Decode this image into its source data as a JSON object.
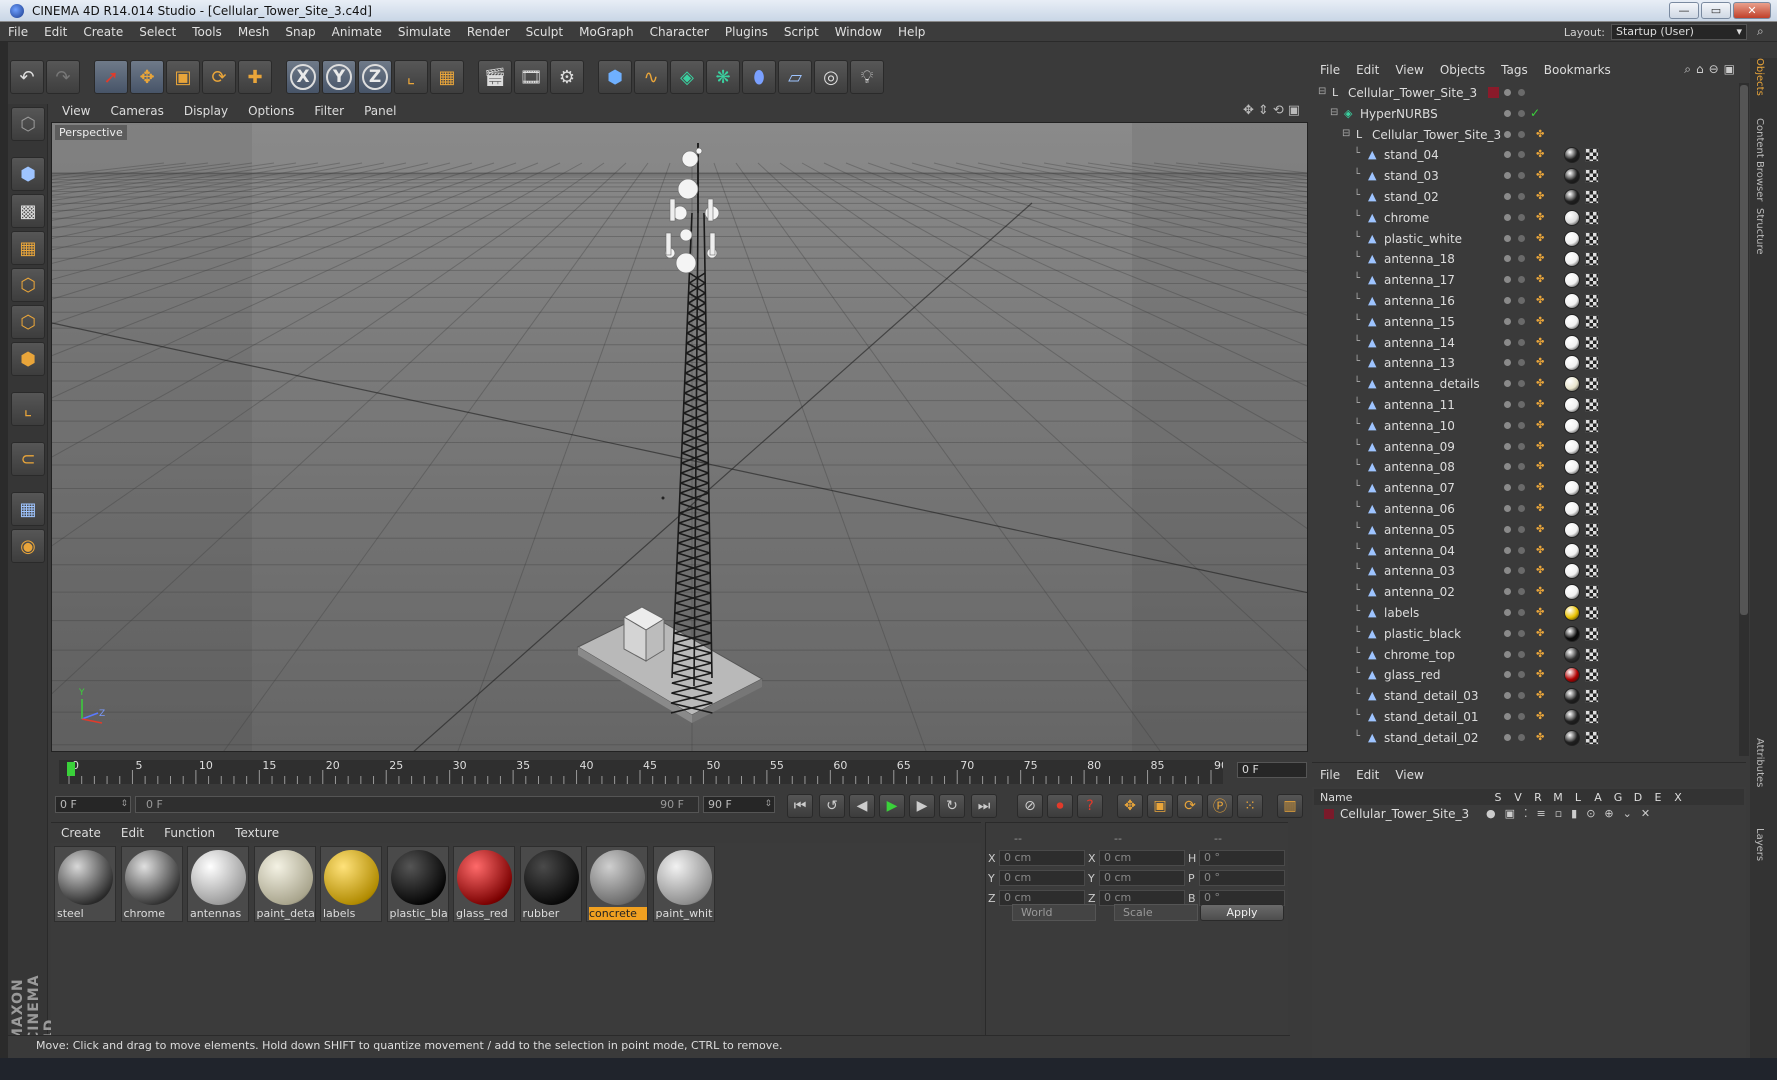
{
  "window": {
    "title": "CINEMA 4D R14.014 Studio - [Cellular_Tower_Site_3.c4d]",
    "buttons": {
      "minimize": "—",
      "maximize": "▭",
      "close": "✕"
    }
  },
  "menubar": {
    "items": [
      "File",
      "Edit",
      "Create",
      "Select",
      "Tools",
      "Mesh",
      "Snap",
      "Animate",
      "Simulate",
      "Render",
      "Sculpt",
      "MoGraph",
      "Character",
      "Plugins",
      "Script",
      "Window",
      "Help"
    ],
    "layout_label": "Layout:",
    "layout_value": "Startup (User)"
  },
  "viewport": {
    "menu": [
      "View",
      "Cameras",
      "Display",
      "Options",
      "Filter",
      "Panel"
    ],
    "label": "Perspective",
    "axis_y": "Y",
    "axis_z": "Z"
  },
  "timeline": {
    "ticks": [
      "0",
      "5",
      "10",
      "15",
      "20",
      "25",
      "30",
      "35",
      "40",
      "45",
      "50",
      "55",
      "60",
      "65",
      "70",
      "75",
      "80",
      "85",
      "90"
    ],
    "current_frame": "0 F"
  },
  "transport": {
    "start_field": "0 F",
    "slider_lo": "0 F",
    "slider_hi": "90 F",
    "end_field": "90 F"
  },
  "materials": {
    "menu": [
      "Create",
      "Edit",
      "Function",
      "Texture"
    ],
    "items": [
      {
        "name": "steel",
        "selected": false,
        "color_a": "#d8d8d8",
        "color_b": "#2a2a2a"
      },
      {
        "name": "chrome",
        "selected": false,
        "color_a": "#e0e0e0",
        "color_b": "#333333"
      },
      {
        "name": "antennas",
        "selected": false,
        "color_a": "#ffffff",
        "color_b": "#9a9a9a"
      },
      {
        "name": "paint_deta",
        "selected": false,
        "color_a": "#f4f2e4",
        "color_b": "#a8a48c"
      },
      {
        "name": "labels",
        "selected": false,
        "color_a": "#ffe27a",
        "color_b": "#b08a00"
      },
      {
        "name": "plastic_bla",
        "selected": false,
        "color_a": "#555555",
        "color_b": "#050505"
      },
      {
        "name": "glass_red",
        "selected": false,
        "color_a": "#ff6a6a",
        "color_b": "#7a0000"
      },
      {
        "name": "rubber",
        "selected": false,
        "color_a": "#4a4a4a",
        "color_b": "#080808"
      },
      {
        "name": "concrete",
        "selected": true,
        "color_a": "#cfcfcf",
        "color_b": "#6a6a6a"
      },
      {
        "name": "paint_whit",
        "selected": false,
        "color_a": "#f2f2f2",
        "color_b": "#8c8c8c"
      }
    ]
  },
  "coords": {
    "head_1": "--",
    "head_2": "--",
    "head_3": "--",
    "rows": [
      {
        "l1": "X",
        "v1": "0 cm",
        "l2": "X",
        "v2": "0 cm",
        "l3": "H",
        "v3": "0 °"
      },
      {
        "l1": "Y",
        "v1": "0 cm",
        "l2": "Y",
        "v2": "0 cm",
        "l3": "P",
        "v3": "0 °"
      },
      {
        "l1": "Z",
        "v1": "0 cm",
        "l2": "Z",
        "v2": "0 cm",
        "l3": "B",
        "v3": "0 °"
      }
    ],
    "world": "World",
    "scale": "Scale",
    "apply": "Apply"
  },
  "status": {
    "text": "Move: Click and drag to move elements. Hold down SHIFT to quantize movement / add to the selection in point mode, CTRL to remove."
  },
  "object_manager": {
    "menu": [
      "File",
      "Edit",
      "View",
      "Objects",
      "Tags",
      "Bookmarks"
    ],
    "objects": [
      {
        "name": "Cellular_Tower_Site_3",
        "level": 0,
        "type": "null",
        "material": ""
      },
      {
        "name": "HyperNURBS",
        "level": 1,
        "type": "nurbs",
        "material": ""
      },
      {
        "name": "Cellular_Tower_Site_3",
        "level": 2,
        "type": "null",
        "material": ""
      },
      {
        "name": "stand_04",
        "level": 3,
        "type": "poly",
        "material": "#202020"
      },
      {
        "name": "stand_03",
        "level": 3,
        "type": "poly",
        "material": "#202020"
      },
      {
        "name": "stand_02",
        "level": 3,
        "type": "poly",
        "material": "#202020"
      },
      {
        "name": "chrome",
        "level": 3,
        "type": "poly",
        "material": "#dcdcdc"
      },
      {
        "name": "plastic_white",
        "level": 3,
        "type": "poly",
        "material": "#f0f0f0"
      },
      {
        "name": "antenna_18",
        "level": 3,
        "type": "poly",
        "material": "#f0f0f0"
      },
      {
        "name": "antenna_17",
        "level": 3,
        "type": "poly",
        "material": "#f0f0f0"
      },
      {
        "name": "antenna_16",
        "level": 3,
        "type": "poly",
        "material": "#f0f0f0"
      },
      {
        "name": "antenna_15",
        "level": 3,
        "type": "poly",
        "material": "#f0f0f0"
      },
      {
        "name": "antenna_14",
        "level": 3,
        "type": "poly",
        "material": "#f0f0f0"
      },
      {
        "name": "antenna_13",
        "level": 3,
        "type": "poly",
        "material": "#f0f0f0"
      },
      {
        "name": "antenna_details",
        "level": 3,
        "type": "poly",
        "material": "#e8e4cc"
      },
      {
        "name": "antenna_11",
        "level": 3,
        "type": "poly",
        "material": "#f0f0f0"
      },
      {
        "name": "antenna_10",
        "level": 3,
        "type": "poly",
        "material": "#f0f0f0"
      },
      {
        "name": "antenna_09",
        "level": 3,
        "type": "poly",
        "material": "#f0f0f0"
      },
      {
        "name": "antenna_08",
        "level": 3,
        "type": "poly",
        "material": "#f0f0f0"
      },
      {
        "name": "antenna_07",
        "level": 3,
        "type": "poly",
        "material": "#f0f0f0"
      },
      {
        "name": "antenna_06",
        "level": 3,
        "type": "poly",
        "material": "#f0f0f0"
      },
      {
        "name": "antenna_05",
        "level": 3,
        "type": "poly",
        "material": "#f0f0f0"
      },
      {
        "name": "antenna_04",
        "level": 3,
        "type": "poly",
        "material": "#f0f0f0"
      },
      {
        "name": "antenna_03",
        "level": 3,
        "type": "poly",
        "material": "#f0f0f0"
      },
      {
        "name": "antenna_02",
        "level": 3,
        "type": "poly",
        "material": "#f0f0f0"
      },
      {
        "name": "labels",
        "level": 3,
        "type": "poly",
        "material": "#e8c000"
      },
      {
        "name": "plastic_black",
        "level": 3,
        "type": "poly",
        "material": "#0a0a0a"
      },
      {
        "name": "chrome_top",
        "level": 3,
        "type": "poly",
        "material": "#303030"
      },
      {
        "name": "glass_red",
        "level": 3,
        "type": "poly",
        "material": "#b00000"
      },
      {
        "name": "stand_detail_03",
        "level": 3,
        "type": "poly",
        "material": "#202020"
      },
      {
        "name": "stand_detail_01",
        "level": 3,
        "type": "poly",
        "material": "#202020"
      },
      {
        "name": "stand_detail_02",
        "level": 3,
        "type": "poly",
        "material": "#202020"
      }
    ]
  },
  "attribute_manager": {
    "menu": [
      "File",
      "Edit",
      "View"
    ],
    "header_name": "Name",
    "header_cols": [
      "S",
      "V",
      "R",
      "M",
      "L",
      "A",
      "G",
      "D",
      "E",
      "X"
    ],
    "row_name": "Cellular_Tower_Site_3"
  },
  "right_tabs": [
    "Objects",
    "Content Browser",
    "Structure",
    "Attributes",
    "Layers"
  ],
  "colors": {
    "accent": "#f0a020",
    "ui_bg": "#3a3a3a",
    "selection": "#e9a53a"
  }
}
